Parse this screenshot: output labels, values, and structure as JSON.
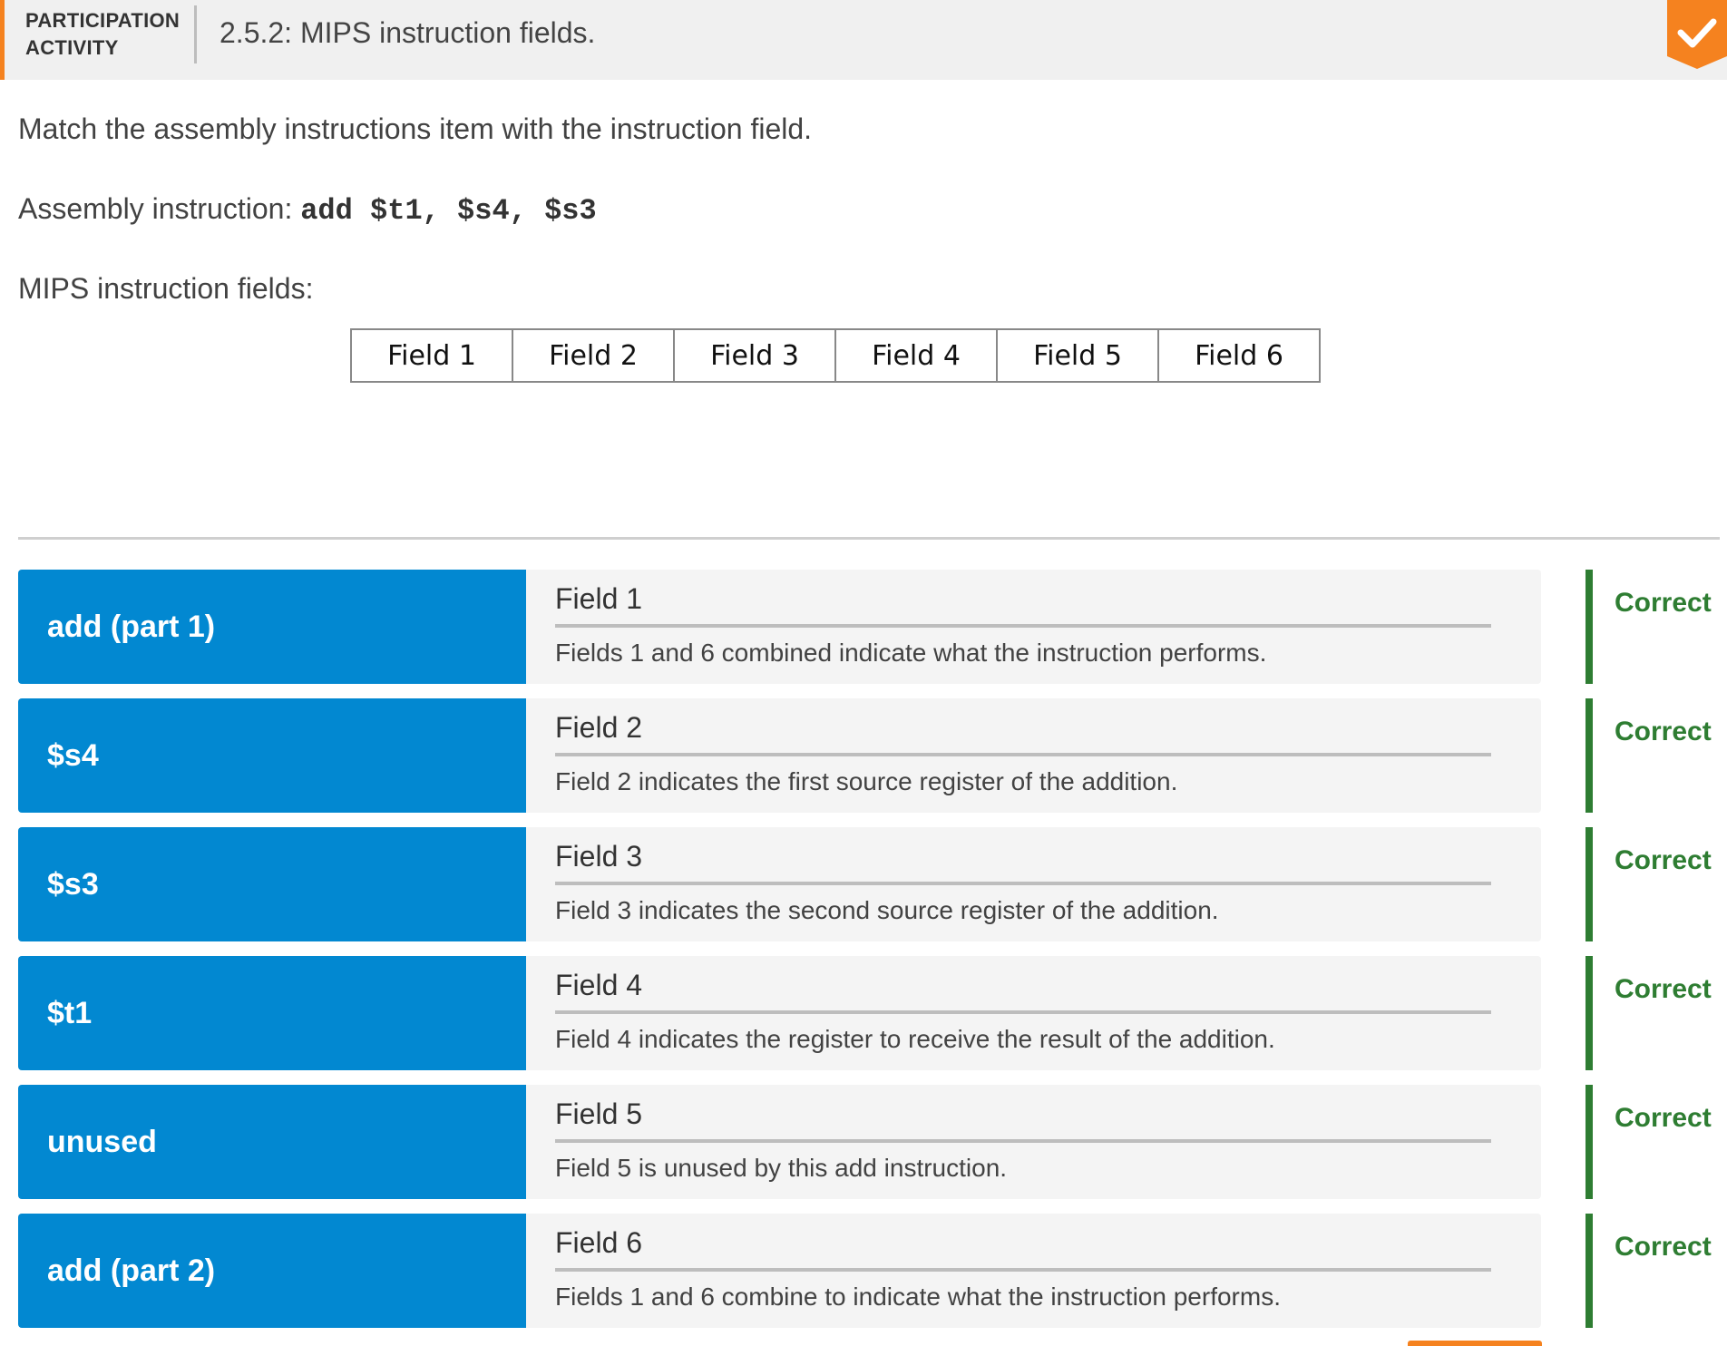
{
  "header": {
    "activity_type_line1": "PARTICIPATION",
    "activity_type_line2": "ACTIVITY",
    "title": "2.5.2: MIPS instruction fields.",
    "completion_icon": "checkmark-icon",
    "accent_color": "#f5821f"
  },
  "instructions": {
    "prompt": "Match the assembly instructions item with the instruction field.",
    "assembly_label": "Assembly instruction:",
    "assembly_code": "add $t1, $s4, $s3",
    "fields_label": "MIPS instruction fields:"
  },
  "fields_table": [
    "Field 1",
    "Field 2",
    "Field 3",
    "Field 4",
    "Field 5",
    "Field 6"
  ],
  "matches": [
    {
      "term": "add (part 1)",
      "bucket": "Field 1",
      "explanation": "Fields 1 and 6 combined indicate what the instruction performs.",
      "status": "Correct"
    },
    {
      "term": "$s4",
      "bucket": "Field 2",
      "explanation": "Field 2 indicates the first source register of the addition.",
      "status": "Correct"
    },
    {
      "term": "$s3",
      "bucket": "Field 3",
      "explanation": "Field 3 indicates the second source register of the addition.",
      "status": "Correct"
    },
    {
      "term": "$t1",
      "bucket": "Field 4",
      "explanation": "Field 4 indicates the register to receive the result of the addition.",
      "status": "Correct"
    },
    {
      "term": "unused",
      "bucket": "Field 5",
      "explanation": "Field 5 is unused by this add instruction.",
      "status": "Correct"
    },
    {
      "term": "add (part 2)",
      "bucket": "Field 6",
      "explanation": "Fields 1 and 6 combine to indicate what the instruction performs.",
      "status": "Correct"
    }
  ],
  "colors": {
    "term_background": "#0288d1",
    "correct": "#2e7d32"
  }
}
